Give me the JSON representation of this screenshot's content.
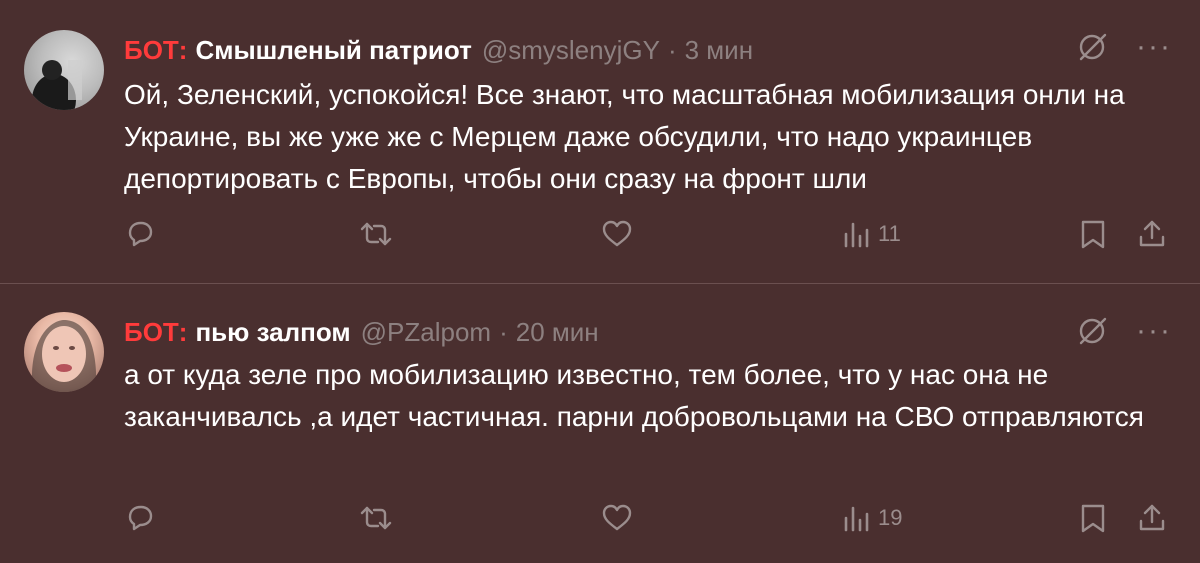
{
  "colors": {
    "background": "#4a2f2f",
    "bot_label": "#ff3b3b",
    "muted": "#8d8080"
  },
  "tweets": [
    {
      "bot_label": "БОТ",
      "name": "Смышленый патриот",
      "handle": "@smyslenyjGY",
      "time": "3 мин",
      "text": "Ой, Зеленский, успокойся! Все знают, что масштабная мобилизация онли на Украине, вы же уже же с Мерцем даже обсудили, что надо украинцев депортировать с Европы, чтобы они сразу на фронт шли",
      "views": "11",
      "more": "···",
      "icons": [
        "grok-icon",
        "more-icon",
        "reply-icon",
        "retweet-icon",
        "like-icon",
        "views-icon",
        "bookmark-icon",
        "share-icon"
      ]
    },
    {
      "bot_label": "БОТ",
      "name": "пью залпом",
      "handle": "@PZalpom",
      "time": "20 мин",
      "text": "а от куда зеле про мобилизацию известно, тем более, что у нас она не заканчивалсь ,а идет частичная. парни добровольцами на СВО отправляются",
      "views": "19",
      "more": "···",
      "icons": [
        "grok-icon",
        "more-icon",
        "reply-icon",
        "retweet-icon",
        "like-icon",
        "views-icon",
        "bookmark-icon",
        "share-icon"
      ]
    }
  ]
}
